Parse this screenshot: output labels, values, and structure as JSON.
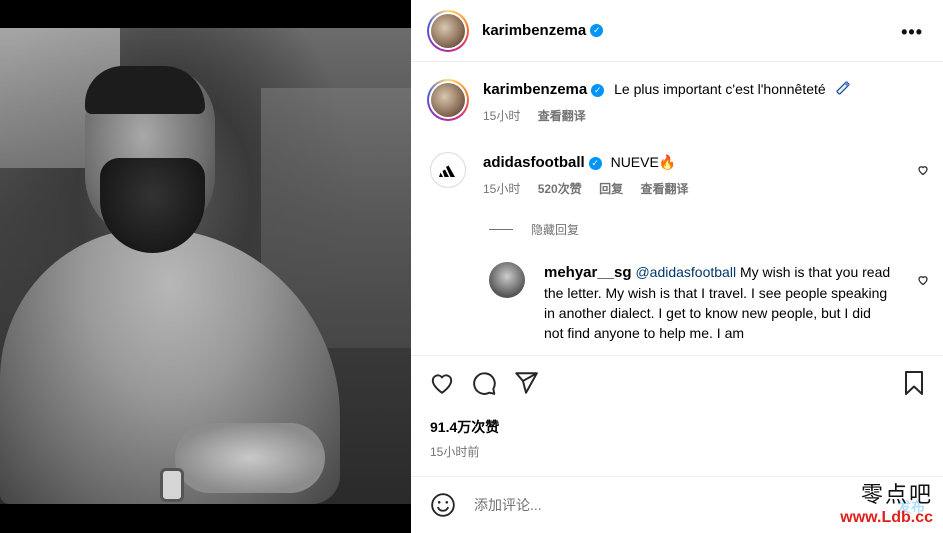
{
  "post": {
    "author": "karimbenzema",
    "more_icon": "more-horizontal-icon",
    "caption": "Le plus important c'est l'honnêteté",
    "caption_time": "15小时",
    "caption_translate": "查看翻译"
  },
  "comments": [
    {
      "user": "adidasfootball",
      "text": "NUEVE",
      "time": "15小时",
      "likes": "520次赞",
      "reply": "回复",
      "translate": "查看翻译"
    }
  ],
  "hide_replies": "隐藏回复",
  "reply": {
    "user": "mehyar__sg",
    "mention": "@adidasfootball",
    "text": "My wish is that you read the letter. My wish is that I travel. I see people speaking in another dialect. I get to know new people, but I did not find anyone to help me. I am"
  },
  "actions": {
    "like_icon": "heart-icon",
    "comment_icon": "comment-icon",
    "share_icon": "send-icon",
    "save_icon": "bookmark-icon"
  },
  "likes_count": "91.4万次赞",
  "post_time": "15小时前",
  "add_comment_placeholder": "添加评论...",
  "post_button": "发布",
  "watermark": {
    "name": "零点吧",
    "url": "www.Ldb.cc"
  },
  "colors": {
    "verified": "#0095f6",
    "muted": "#737373",
    "watermark_url": "#e0201b"
  }
}
